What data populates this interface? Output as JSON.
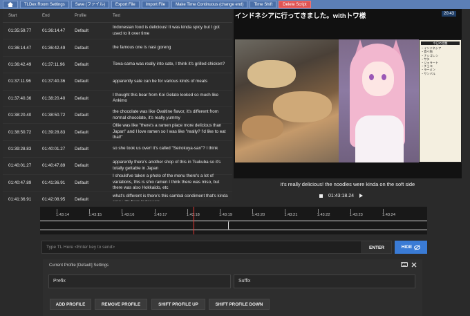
{
  "toolbar": {
    "home_icon": "home-icon",
    "buttons": [
      "TLDex Room Settings",
      "Save (ファイル)",
      "Export File",
      "Import File",
      "Make Time Continuous (change end)",
      "Time Shift",
      "Delete Script"
    ],
    "accent": "#5c7fb6",
    "danger": "#e05353"
  },
  "table": {
    "headers": {
      "start": "Start",
      "end": "End",
      "profile": "Profile",
      "text": "Text"
    },
    "rows": [
      {
        "start": "01:35:59.77",
        "end": "01:36:14.47",
        "profile": "Default",
        "text": "Indonesian food is delicious! It was kinda spicy but I got used to it over time"
      },
      {
        "start": "01:36:14.47",
        "end": "01:36:42.49",
        "profile": "Default",
        "text": "the famous one is nasi goreng"
      },
      {
        "start": "01:36:42.49",
        "end": "01:37:11.96",
        "profile": "Default",
        "text": "Towa-sama was really into sate, I think it's grilled chicken?"
      },
      {
        "start": "01:37:11.96",
        "end": "01:37:40.36",
        "profile": "Default",
        "text": "apparently sate can be for various kinds of meats"
      },
      {
        "start": "01:37:40.36",
        "end": "01:38:20.40",
        "profile": "Default",
        "text": "I thought this bear from Koi Gelato looked so much like Ankimo"
      },
      {
        "start": "01:38:20.40",
        "end": "01:38:50.72",
        "profile": "Default",
        "text": "the chocolate was like Ovaltine flavor, it's different from normal chocolate, it's really yummy"
      },
      {
        "start": "01:38:50.72",
        "end": "01:39:28.83",
        "profile": "Default",
        "text": "Ollie was like \"there's a ramen place more delicious than Japan\" and I love ramen so I was like \"really? I'd like to eat that!\""
      },
      {
        "start": "01:39:28.83",
        "end": "01:40:01.27",
        "profile": "Default",
        "text": "so she took us over! it's called \"Seirokuya-san\"? I think"
      },
      {
        "start": "01:40:01.27",
        "end": "01:40:47.89",
        "profile": "Default",
        "text": "apparently there's another shop of this in Tsukuba so it's totally gettable in Japan"
      },
      {
        "start": "01:40:47.89",
        "end": "01:41:36.91",
        "profile": "Default",
        "text": "I should've taken a photo of the menu there's a lot of variations, this is shio ramen I think there was miso, but there was also Hokkaido, etc"
      },
      {
        "start": "01:41:36.91",
        "end": "01:42:08.95",
        "profile": "Default",
        "text": "what's different is there's this sambal condiment that's kinda spicy, it's from Indonesia"
      }
    ]
  },
  "video": {
    "title": "インドネシアに行ってきました。withトワ様",
    "badge": "20:43",
    "list_header": "今日の話題",
    "list_items": [
      "・インドネシア",
      "・食べ物",
      "・ナシゴレン",
      "・サテ",
      "・ジェラート",
      "・チョコ",
      "・ラーメン",
      "・サンバル"
    ]
  },
  "subtitle": "it's really delicious! the noodles were kinda on the soft side",
  "player": {
    "time": "01:43:18.24",
    "stop_icon": "stop-icon",
    "play_icon": "play-icon"
  },
  "timeline": {
    "ticks": [
      "1:43:14",
      "1:43:15",
      "1:43:16",
      "1:43:17",
      "1:43:18",
      "1:43:19",
      "1:43:20",
      "1:43:21",
      "1:43:22",
      "1:43:23",
      "1:43:24"
    ]
  },
  "input": {
    "placeholder": "Type TL Here <Enter key to send>",
    "enter_label": "ENTER",
    "hide_label": "HIDE",
    "hide_icon": "eye-off-icon"
  },
  "profile": {
    "title": "Current Profile [Default] Settings",
    "prefix_placeholder": "Prefix",
    "suffix_placeholder": "Suffix",
    "buttons": {
      "add": "ADD PROFILE",
      "remove": "REMOVE PROFILE",
      "up": "SHIFT PROFILE UP",
      "down": "SHIFT PROFILE DOWN"
    },
    "keyboard_icon": "keyboard-icon",
    "close_icon": "close-icon"
  }
}
